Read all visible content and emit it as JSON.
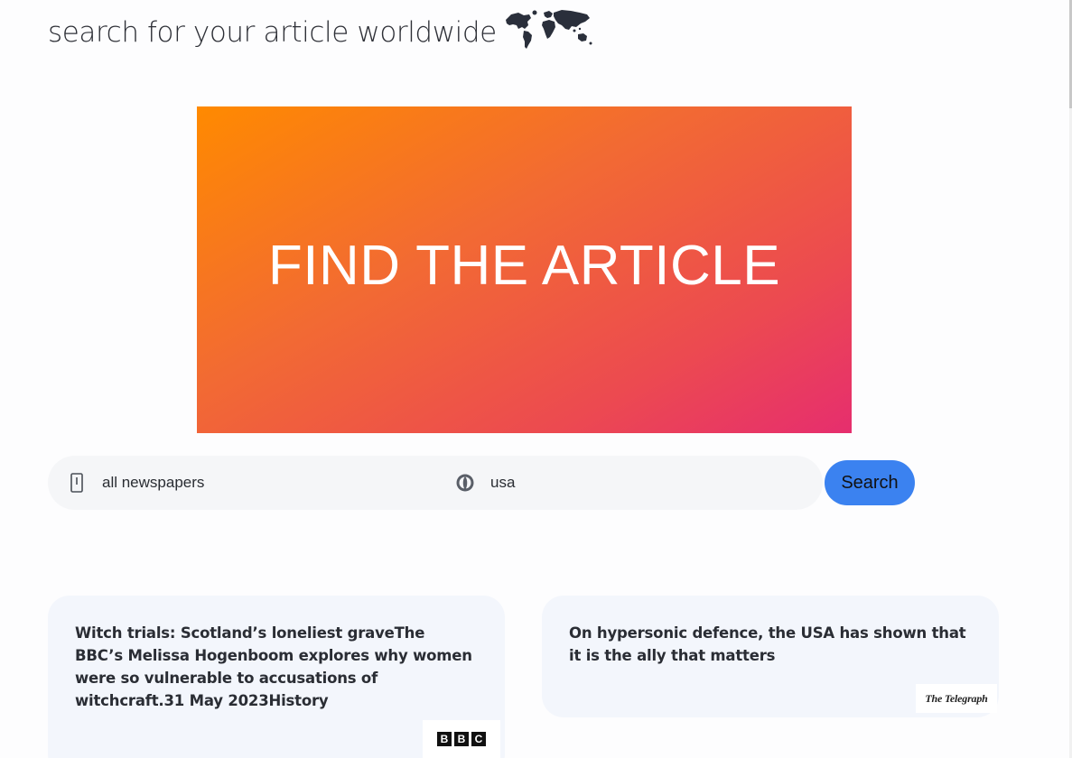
{
  "header": {
    "title": "search for your article worldwide",
    "map_icon": "world-map-icon"
  },
  "hero": {
    "title": "FIND THE ARTICLE",
    "gradient": [
      "#ff8a00",
      "#e62e6e"
    ]
  },
  "search": {
    "newspaper_value": "all newspapers",
    "newspaper_icon": "newspaper-icon",
    "country_value": "usa",
    "country_icon": "globe-icon",
    "button_label": "Search",
    "button_color": "#3b82f0"
  },
  "articles": [
    {
      "text": "Witch trials: Scotland’s loneliest graveThe BBC’s Melissa Hogenboom explores why women were so vulnerable to accusations of witchcraft.31 May 2023History",
      "source_logo": "BBC"
    },
    {
      "text": "On hypersonic defence, the USA has shown that it is the ally that matters",
      "source_logo": "The Telegraph"
    }
  ]
}
